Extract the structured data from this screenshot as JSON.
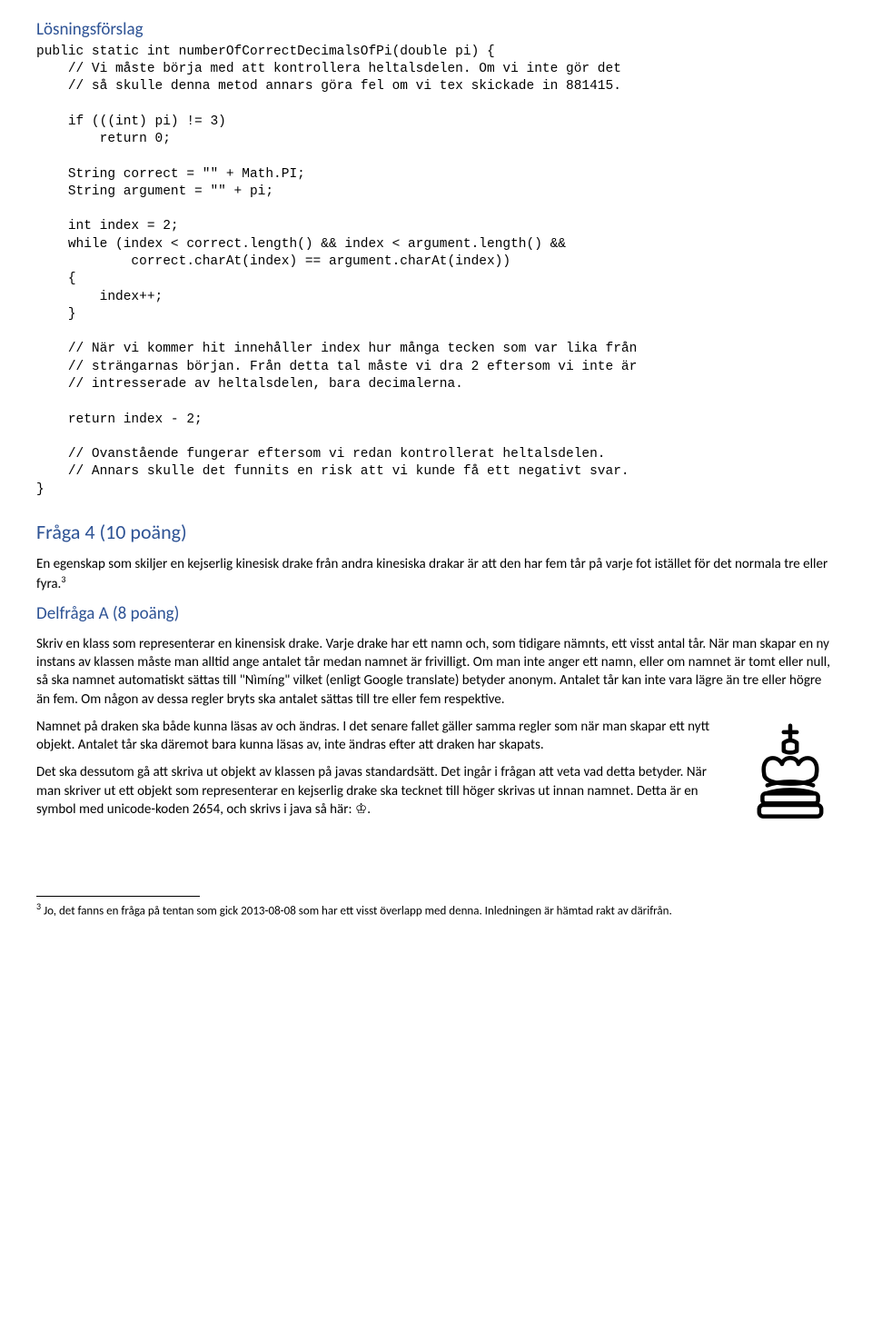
{
  "headings": {
    "losning": "Lösningsförslag",
    "fraga4": "Fråga 4 (10 poäng)",
    "delfragaA": "Delfråga A (8 poäng)"
  },
  "code_block": "public static int numberOfCorrectDecimalsOfPi(double pi) {\n    // Vi måste börja med att kontrollera heltalsdelen. Om vi inte gör det\n    // så skulle denna metod annars göra fel om vi tex skickade in 881415.\n\n    if (((int) pi) != 3)\n        return 0;\n\n    String correct = \"\" + Math.PI;\n    String argument = \"\" + pi;\n\n    int index = 2;\n    while (index < correct.length() && index < argument.length() &&\n            correct.charAt(index) == argument.charAt(index))\n    {\n        index++;\n    }\n\n    // När vi kommer hit innehåller index hur många tecken som var lika från\n    // strängarnas början. Från detta tal måste vi dra 2 eftersom vi inte är\n    // intresserade av heltalsdelen, bara decimalerna.\n\n    return index - 2;\n\n    // Ovanstående fungerar eftersom vi redan kontrollerat heltalsdelen.\n    // Annars skulle det funnits en risk att vi kunde få ett negativt svar.\n}",
  "fraga4_intro": "En egenskap som skiljer en kejserlig kinesisk drake från andra kinesiska drakar är att den har fem tår på varje fot istället för det normala tre eller fyra.",
  "fraga4_footref": "3",
  "delfragaA_p1": "Skriv en klass som representerar en kinensisk drake. Varje drake har ett namn och, som tidigare nämnts, ett visst antal tår. När man skapar en ny instans av klassen måste man alltid ange antalet tår medan namnet är frivilligt. Om man inte anger ett namn, eller om namnet är tomt eller null, så ska namnet automatiskt sättas till \"Nìmíng\" vilket (enligt Google translate) betyder anonym. Antalet tår kan inte vara lägre än tre eller högre än fem. Om någon av dessa regler bryts ska antalet sättas till tre eller fem respektive.",
  "delfragaA_p2": "Namnet på draken ska både kunna läsas av och ändras. I det senare fallet gäller samma regler som när man skapar ett nytt objekt. Antalet tår ska däremot bara kunna läsas av, inte ändras efter att draken har skapats.",
  "delfragaA_p3": "Det ska dessutom gå att skriva ut objekt av klassen på javas standardsätt. Det ingår i frågan att veta vad detta betyder. När man skriver ut ett objekt som representerar en kejserlig drake ska tecknet till höger skrivas ut innan namnet. Detta är en symbol med unicode-koden 2654, och skrivs i java så här: ♔.",
  "footnote_ref": "3",
  "footnote_text": " Jo, det fanns en fråga på tentan som gick 2013-08-08 som har ett visst överlapp med denna. Inledningen är hämtad rakt av därifrån.",
  "icon": {
    "king": "chess-king-icon"
  }
}
